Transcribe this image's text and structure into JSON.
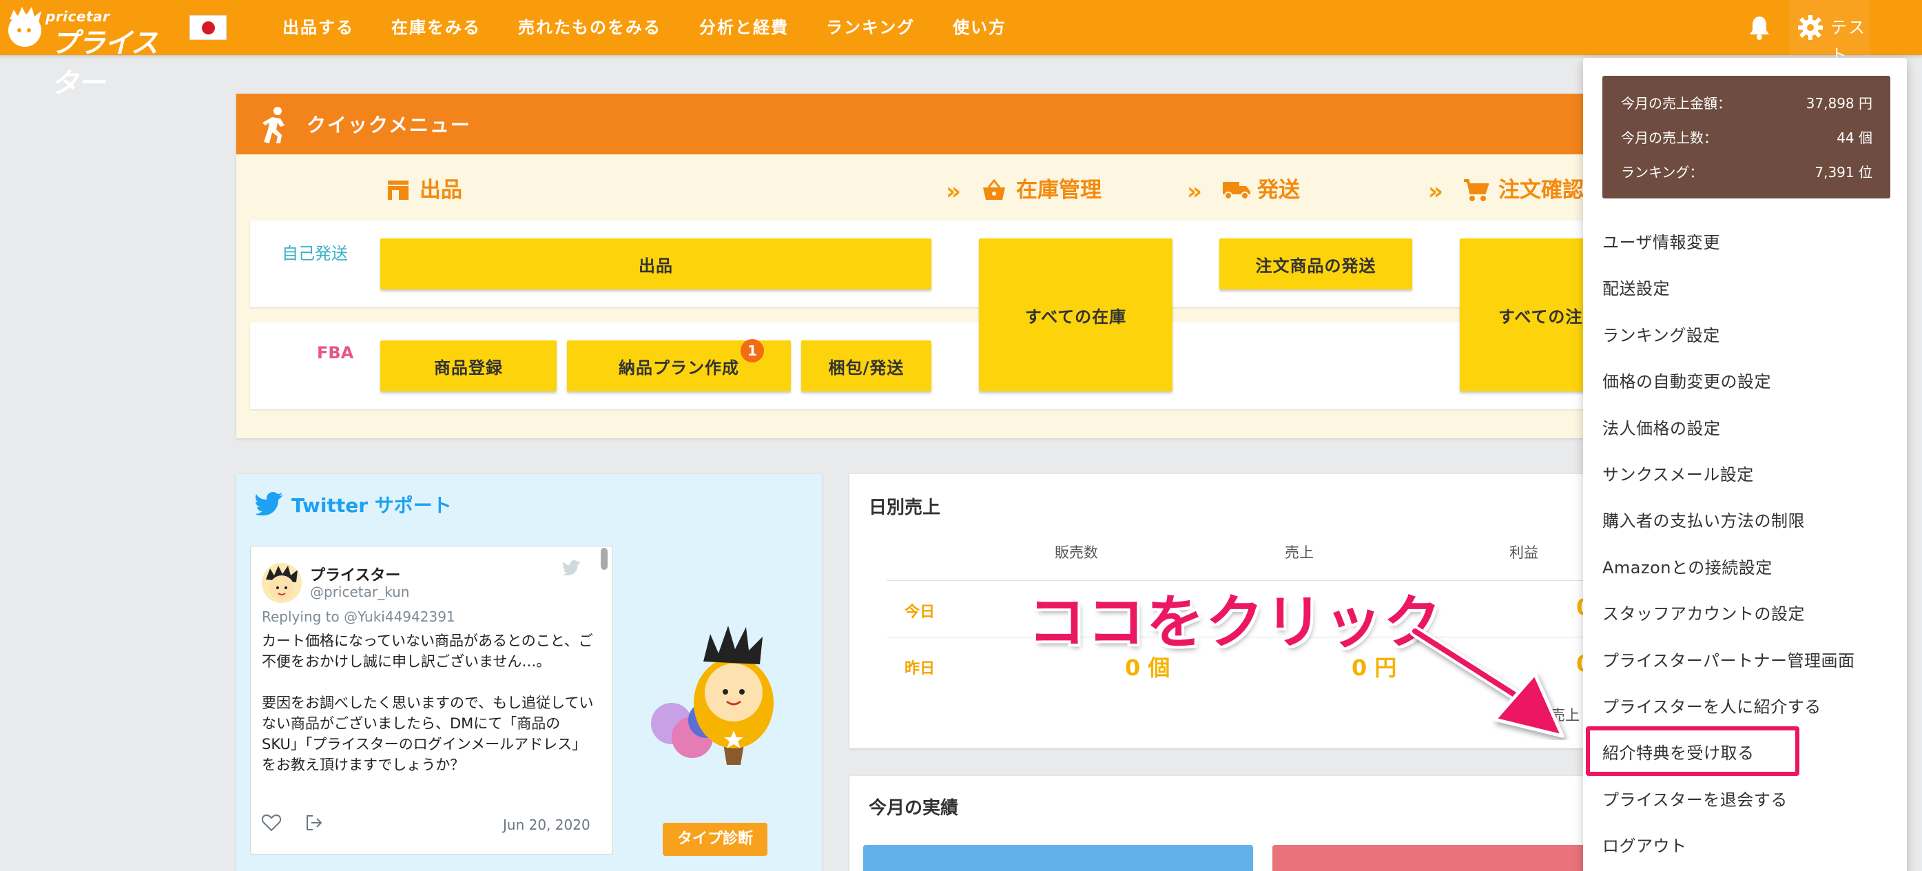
{
  "header": {
    "logo_small": "pricetar",
    "logo_main": "プライスター",
    "nav": [
      "出品する",
      "在庫をみる",
      "売れたものをみる",
      "分析と経費",
      "ランキング",
      "使い方"
    ],
    "user_label": "テスト"
  },
  "quick_menu": {
    "title": "クイックメニュー",
    "steps": [
      "出品",
      "在庫管理",
      "発送",
      "注文確認"
    ],
    "self_ship_label": "自己発送",
    "fba_label": "FBA",
    "buttons": {
      "listing": "出品",
      "all_inventory": "すべての在庫",
      "ship_orders": "注文商品の発送",
      "all_orders": "すべての注",
      "register_item": "商品登録",
      "delivery_plan": "納品プラン作成",
      "pack_ship": "梱包/発送"
    },
    "badge_count": "1"
  },
  "twitter": {
    "title": "Twitter サポート",
    "name": "プライスター",
    "handle": "@pricetar_kun",
    "reply_to": "Replying to @Yuki44942391",
    "text": "カート価格になっていない商品があるとのこと、ご\n不便をおかけし誠に申し訳ございません…。\n\n要因をお調べしたく思いますので、もし追従してい\nない商品がございましたら、DMにて「商品の\nSKU」「プライスターのログインメールアドレス」\nをお教え頂けますでしょうか？",
    "date": "Jun 20, 2020",
    "type_button": "タイプ診断"
  },
  "daily_sales": {
    "title": "日別売上",
    "columns": [
      "販売数",
      "売上",
      "利益"
    ],
    "today_label": "今日",
    "yesterday_label": "昨日",
    "yesterday_count": "0 個",
    "yesterday_sales": "0 円",
    "partial_right_today": "0",
    "partial_right_yesterday": "0",
    "partial_link": "売上"
  },
  "monthly": {
    "title": "今月の実績"
  },
  "dropdown": {
    "stats": [
      {
        "label": "今月の売上金額：",
        "value": "37,898 円"
      },
      {
        "label": "今月の売上数：",
        "value": "44 個"
      },
      {
        "label": "ランキング：",
        "value": "7,391 位"
      }
    ],
    "items": [
      "ユーザ情報変更",
      "配送設定",
      "ランキング設定",
      "価格の自動変更の設定",
      "法人価格の設定",
      "サンクスメール設定",
      "購入者の支払い方法の制限",
      "Amazonとの接続設定",
      "スタッフアカウントの設定",
      "プライスターパートナー管理画面",
      "プライスターを人に紹介する",
      "紹介特典を受け取る",
      "プライスターを退会する",
      "ログアウト"
    ]
  },
  "annotation": "ココをクリック",
  "colors": {
    "header": "#f99c0c",
    "accent_orange": "#f3841c",
    "button_yellow": "#fdd40b",
    "highlight_pink": "#ec1763",
    "stats_brown": "#6e4c3f"
  }
}
